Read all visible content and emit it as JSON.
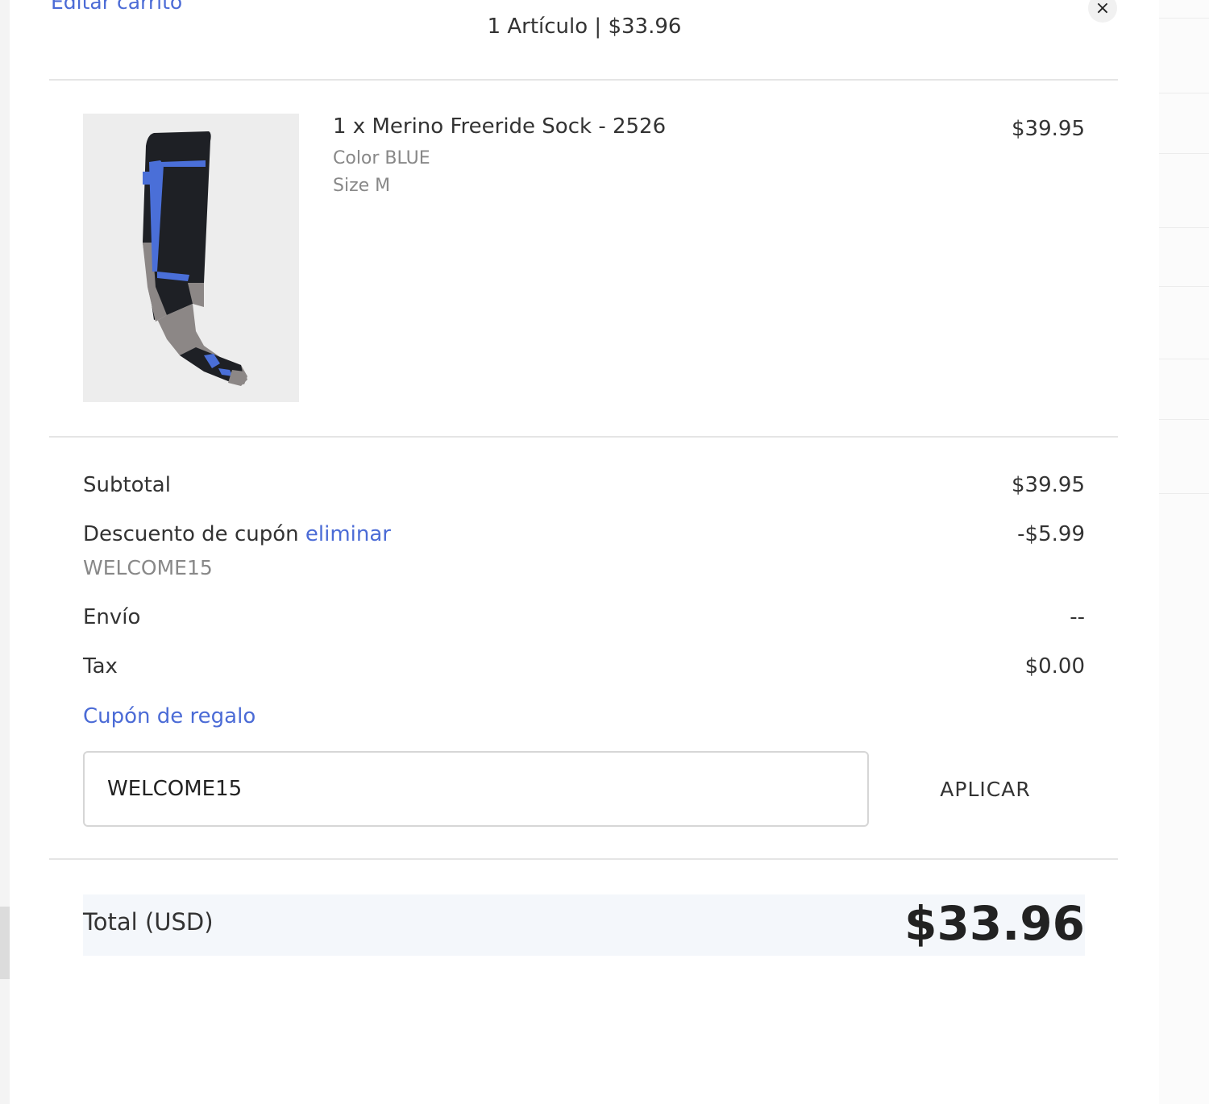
{
  "header": {
    "edit_cart_link": "Editar carrito",
    "summary": "1 Artículo | $33.96",
    "close_icon": "close-icon",
    "close_glyph": "×"
  },
  "item": {
    "title": "1 x Merino Freeride Sock - 2526",
    "color": "Color BLUE",
    "size": "Size M",
    "price": "$39.95",
    "image": "sock-product-image"
  },
  "totals": {
    "subtotal_label": "Subtotal",
    "subtotal_value": "$39.95",
    "discount_label": "Descuento de cupón",
    "discount_remove_link": "eliminar",
    "discount_code": "WELCOME15",
    "discount_value": "-$5.99",
    "shipping_label": "Envío",
    "shipping_value": "--",
    "tax_label": "Tax",
    "tax_value": "$0.00"
  },
  "coupon": {
    "gift_link": "Cupón de regalo",
    "input_value": "WELCOME15",
    "apply_label": "APLICAR"
  },
  "total": {
    "label": "Total (USD)",
    "value": "$33.96"
  },
  "colors": {
    "link": "#4b6bd6",
    "sock_blue": "#4a6fd8",
    "total_bar": "#f4f7fb"
  }
}
